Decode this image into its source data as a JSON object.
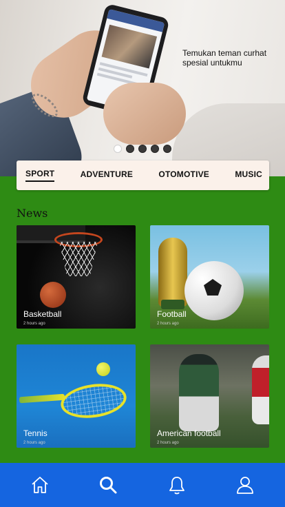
{
  "hero": {
    "caption": "Temukan teman curhat spesial untukmu",
    "slides_total": 5,
    "active_slide": 1
  },
  "tabs": [
    {
      "label": "SPORT",
      "active": true
    },
    {
      "label": "ADVENTURE",
      "active": false
    },
    {
      "label": "OTOMOTIVE",
      "active": false
    },
    {
      "label": "MUSIC",
      "active": false
    }
  ],
  "news": {
    "title": "News",
    "cards": [
      {
        "label": "Basketball",
        "time": "2 hours ago"
      },
      {
        "label": "Football",
        "time": "2 hours ago"
      },
      {
        "label": "Tennis",
        "time": "2 hours ago"
      },
      {
        "label": "American football",
        "time": "2 hours ago"
      }
    ]
  },
  "bottom_nav": {
    "items": [
      {
        "icon": "home-icon",
        "active": false
      },
      {
        "icon": "search-icon",
        "active": true
      },
      {
        "icon": "bell-icon",
        "active": false
      },
      {
        "icon": "user-icon",
        "active": false
      }
    ]
  },
  "colors": {
    "background": "#2e8b14",
    "nav": "#1565e0",
    "tabs_bg": "#fbf1ea"
  }
}
